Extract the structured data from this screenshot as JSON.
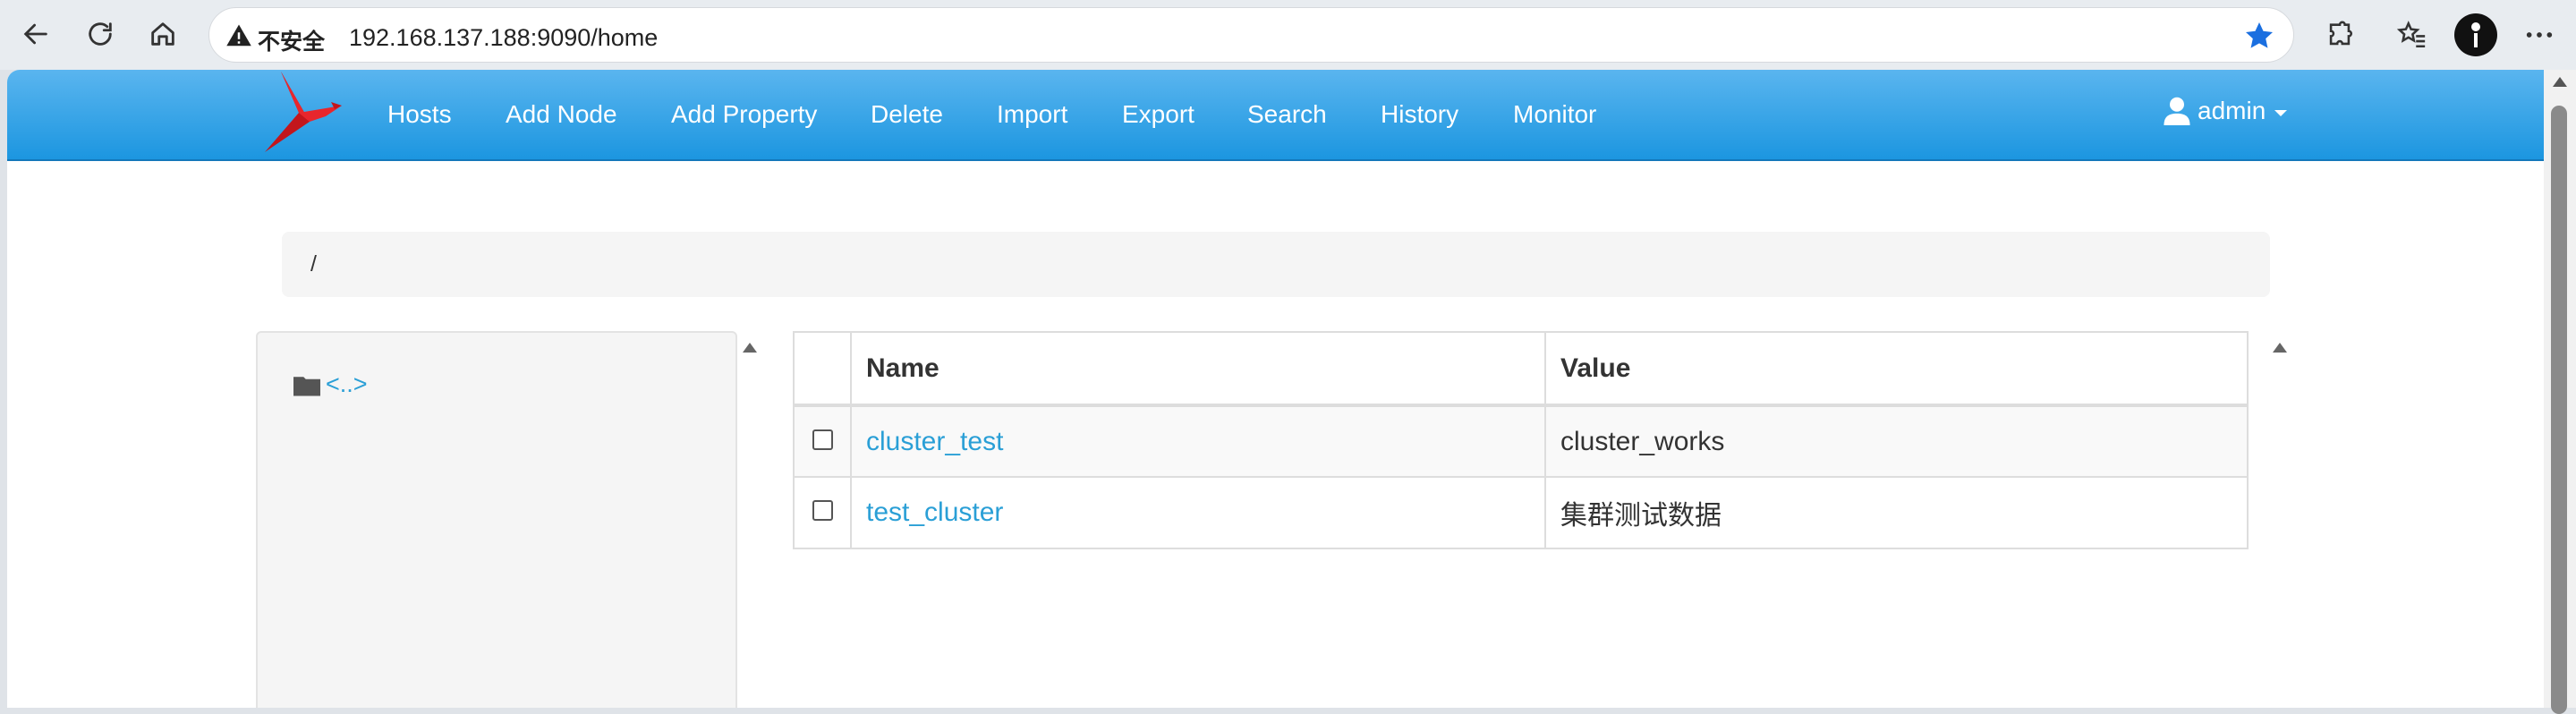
{
  "browser": {
    "security_label": "不安全",
    "url": "192.168.137.188:9090/home"
  },
  "app": {
    "menu": [
      {
        "label": "Hosts"
      },
      {
        "label": "Add Node"
      },
      {
        "label": "Add Property"
      },
      {
        "label": "Delete"
      },
      {
        "label": "Import"
      },
      {
        "label": "Export"
      },
      {
        "label": "Search"
      },
      {
        "label": "History"
      },
      {
        "label": "Monitor"
      }
    ],
    "user": "admin",
    "brand_color": "#2a9fd6"
  },
  "breadcrumb": {
    "path": "/"
  },
  "tree": {
    "parent_link": "<..>"
  },
  "table": {
    "headers": {
      "name": "Name",
      "value": "Value"
    },
    "rows": [
      {
        "name": "cluster_test",
        "value": "cluster_works"
      },
      {
        "name": "test_cluster",
        "value": "集群测试数据"
      }
    ]
  }
}
